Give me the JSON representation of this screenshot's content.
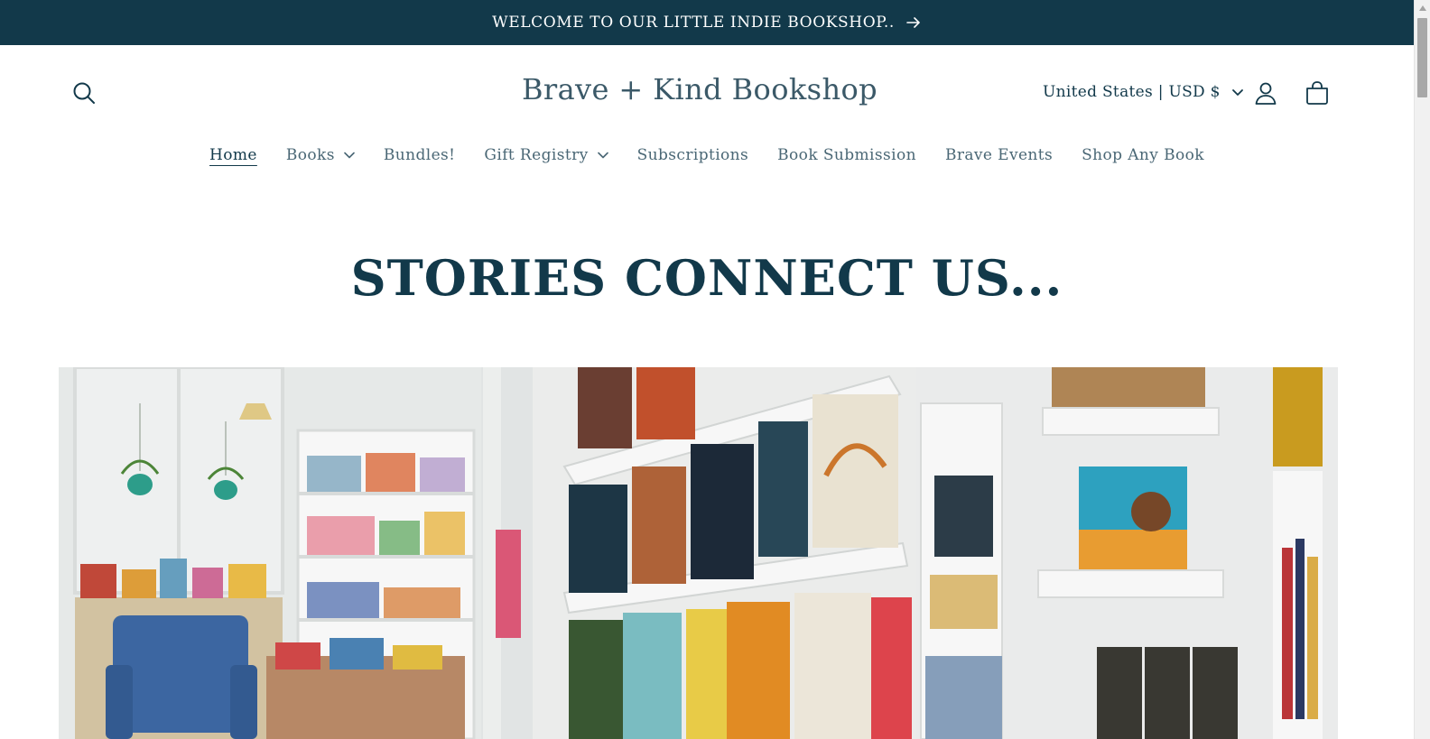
{
  "announcement": {
    "text": "WELCOME TO OUR LITTLE INDIE BOOKSHOP..",
    "icon": "arrow-right-icon"
  },
  "header": {
    "logo": "Brave + Kind Bookshop",
    "country_selector": "United States | USD $",
    "icons": [
      "search-icon",
      "account-icon",
      "cart-icon"
    ]
  },
  "nav": {
    "items": [
      {
        "label": "Home",
        "active": true
      },
      {
        "label": "Books",
        "dropdown": true
      },
      {
        "label": "Bundles!"
      },
      {
        "label": "Gift Registry",
        "dropdown": true
      },
      {
        "label": "Subscriptions"
      },
      {
        "label": "Book Submission"
      },
      {
        "label": "Brave Events"
      },
      {
        "label": "Shop Any Book"
      }
    ]
  },
  "hero": {
    "title": "STORIES CONNECT US..."
  },
  "colors": {
    "brand": "#12394a",
    "nav_text": "#4a6775",
    "logo_text": "#3b5968",
    "background": "#ffffff"
  }
}
